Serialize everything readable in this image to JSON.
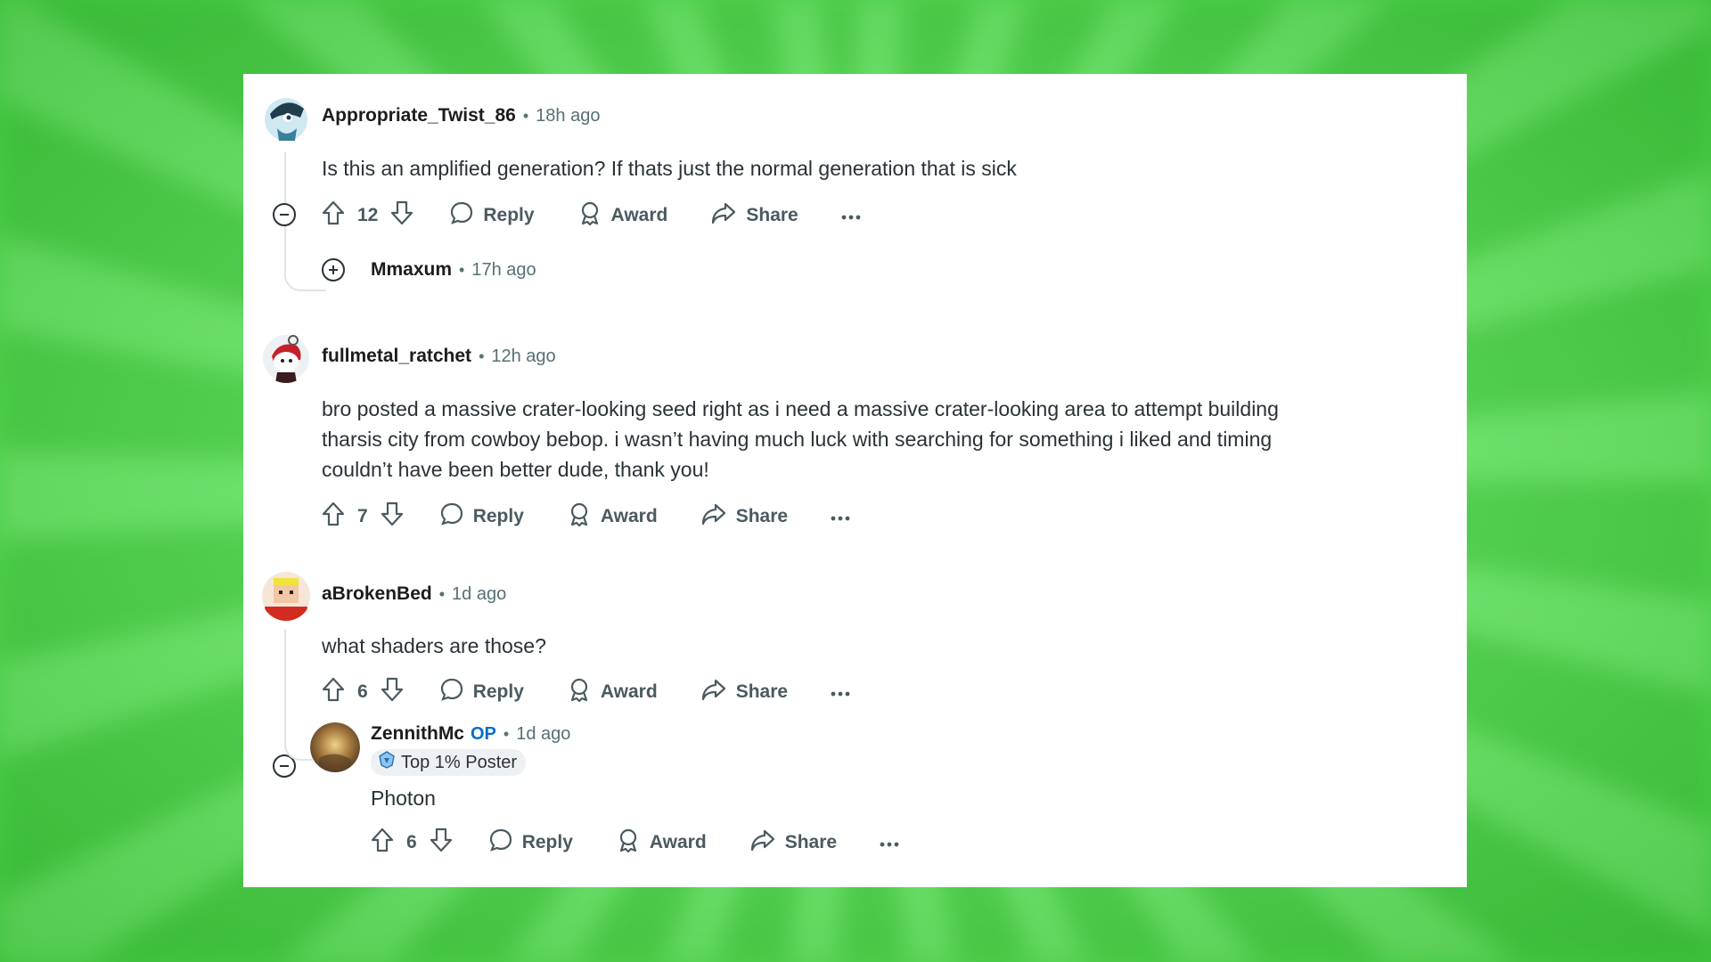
{
  "comments": [
    {
      "username": "Appropriate_Twist_86",
      "time": "18h ago",
      "body": "Is this an amplified generation? If thats just the normal generation that is sick",
      "votes": "12",
      "reply_label": "Reply",
      "award_label": "Award",
      "share_label": "Share",
      "collapsed_reply": {
        "username": "Mmaxum",
        "time": "17h ago"
      }
    },
    {
      "username": "fullmetal_ratchet",
      "time": "12h ago",
      "body_lines": [
        "bro posted a massive crater-looking seed right as i need a massive crater-looking area to attempt building",
        "tharsis city from cowboy bebop. i wasn’t having much luck with searching for something i liked and timing",
        "couldn’t have been better dude, thank you!"
      ],
      "votes": "7",
      "reply_label": "Reply",
      "award_label": "Award",
      "share_label": "Share"
    },
    {
      "username": "aBrokenBed",
      "time": "1d ago",
      "body": "what shaders are those?",
      "votes": "6",
      "reply_label": "Reply",
      "award_label": "Award",
      "share_label": "Share",
      "reply": {
        "username": "ZennithMc",
        "op_badge": "OP",
        "time": "1d ago",
        "flair": "Top 1% Poster",
        "body": "Photon",
        "votes": "6",
        "reply_label": "Reply",
        "award_label": "Award",
        "share_label": "Share"
      }
    }
  ],
  "separator": "•",
  "colors": {
    "text": "#2a3236",
    "meta": "#576f76",
    "op": "#0a6cc9",
    "background": "#5fe05c",
    "card": "#ffffff"
  }
}
